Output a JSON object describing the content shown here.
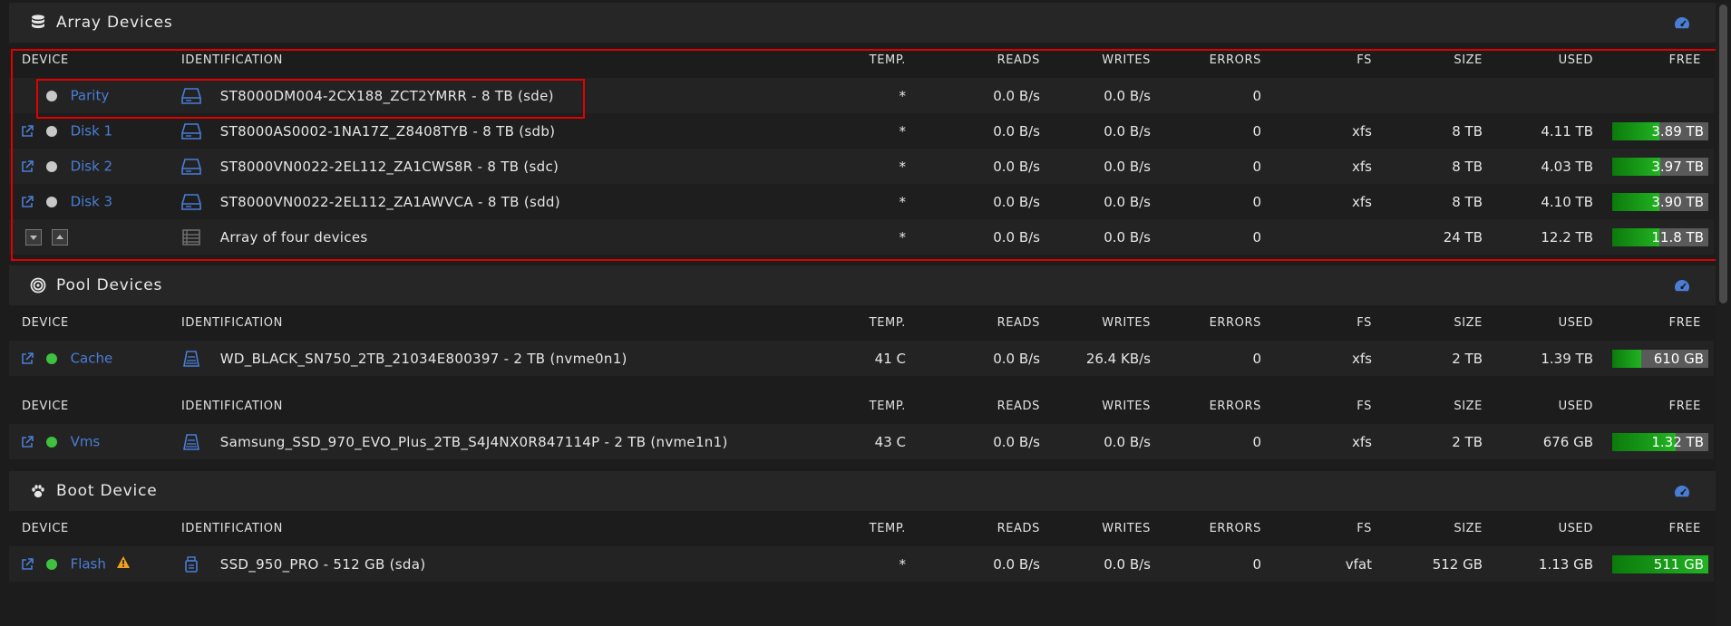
{
  "columns": {
    "device": "DEVICE",
    "identification": "IDENTIFICATION",
    "temp": "TEMP.",
    "reads": "READS",
    "writes": "WRITES",
    "errors": "ERRORS",
    "fs": "FS",
    "size": "SIZE",
    "used": "USED",
    "free": "FREE"
  },
  "array": {
    "title": "Array Devices",
    "rows": [
      {
        "name": "Parity",
        "ident": "ST8000DM004-2CX188_ZCT2YMRR - 8 TB (sde)",
        "temp": "*",
        "reads": "0.0 B/s",
        "writes": "0.0 B/s",
        "errors": "0",
        "fs": "",
        "size": "",
        "used": "",
        "free": ""
      },
      {
        "name": "Disk 1",
        "ident": "ST8000AS0002-1NA17Z_Z8408TYB - 8 TB (sdb)",
        "temp": "*",
        "reads": "0.0 B/s",
        "writes": "0.0 B/s",
        "errors": "0",
        "fs": "xfs",
        "size": "8 TB",
        "used": "4.11 TB",
        "free": "3.89 TB",
        "free_fraction": 0.49
      },
      {
        "name": "Disk 2",
        "ident": "ST8000VN0022-2EL112_ZA1CWS8R - 8 TB (sdc)",
        "temp": "*",
        "reads": "0.0 B/s",
        "writes": "0.0 B/s",
        "errors": "0",
        "fs": "xfs",
        "size": "8 TB",
        "used": "4.03 TB",
        "free": "3.97 TB",
        "free_fraction": 0.5
      },
      {
        "name": "Disk 3",
        "ident": "ST8000VN0022-2EL112_ZA1AWVCA - 8 TB (sdd)",
        "temp": "*",
        "reads": "0.0 B/s",
        "writes": "0.0 B/s",
        "errors": "0",
        "fs": "xfs",
        "size": "8 TB",
        "used": "4.10 TB",
        "free": "3.90 TB",
        "free_fraction": 0.49
      }
    ],
    "summary": {
      "ident": "Array of four devices",
      "temp": "*",
      "reads": "0.0 B/s",
      "writes": "0.0 B/s",
      "errors": "0",
      "size": "24 TB",
      "used": "12.2 TB",
      "free": "11.8 TB",
      "free_fraction": 0.49
    }
  },
  "pool": {
    "title": "Pool Devices",
    "cache": {
      "name": "Cache",
      "ident": "WD_BLACK_SN750_2TB_21034E800397 - 2 TB (nvme0n1)",
      "temp": "41 C",
      "reads": "0.0 B/s",
      "writes": "26.4 KB/s",
      "errors": "0",
      "fs": "xfs",
      "size": "2 TB",
      "used": "1.39 TB",
      "free": "610 GB",
      "free_fraction": 0.3
    },
    "vms": {
      "name": "Vms",
      "ident": "Samsung_SSD_970_EVO_Plus_2TB_S4J4NX0R847114P - 2 TB (nvme1n1)",
      "temp": "43 C",
      "reads": "0.0 B/s",
      "writes": "0.0 B/s",
      "errors": "0",
      "fs": "xfs",
      "size": "2 TB",
      "used": "676 GB",
      "free": "1.32 TB",
      "free_fraction": 0.66
    }
  },
  "boot": {
    "title": "Boot Device",
    "flash": {
      "name": "Flash",
      "ident": "SSD_950_PRO - 512 GB (sda)",
      "temp": "*",
      "reads": "0.0 B/s",
      "writes": "0.0 B/s",
      "errors": "0",
      "fs": "vfat",
      "size": "512 GB",
      "used": "1.13 GB",
      "free": "511 GB",
      "free_fraction": 1.0
    }
  },
  "colors": {
    "accent": "#4a7dd6",
    "online": "#3ec13e",
    "standby": "#c8c8c8",
    "highlight": "#e00000",
    "warning": "#f0a020"
  }
}
